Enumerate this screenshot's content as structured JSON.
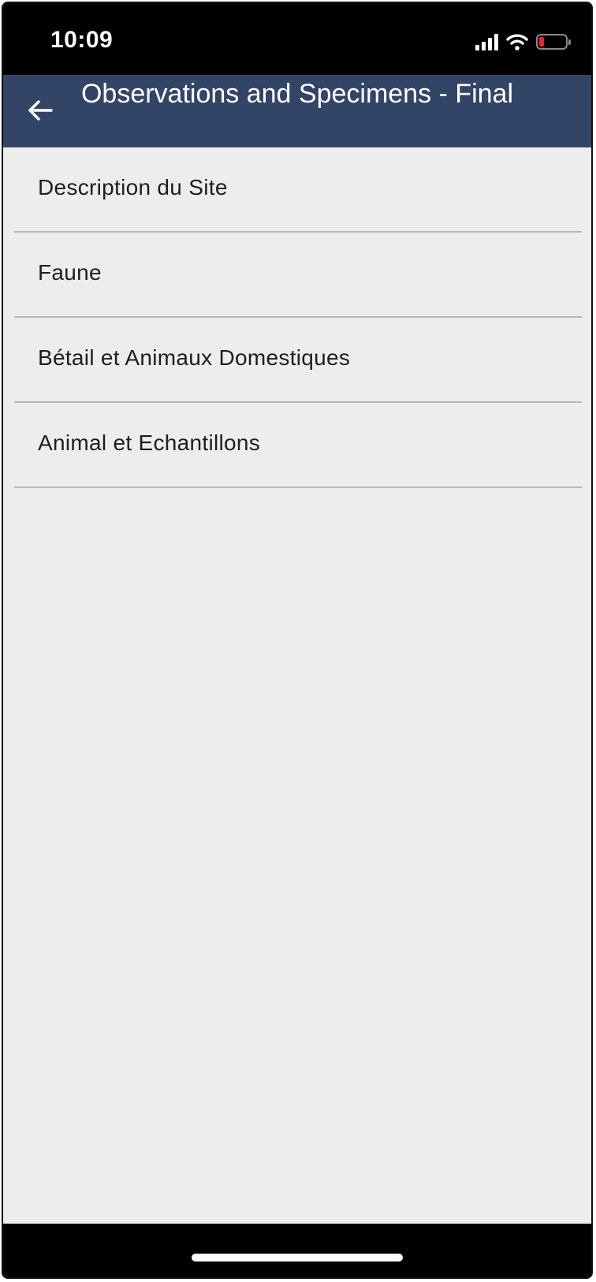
{
  "status_bar": {
    "time": "10:09",
    "icons": [
      "cellular-signal-icon",
      "wifi-icon",
      "battery-icon"
    ],
    "battery_color": "#e8262b"
  },
  "header": {
    "title": "Observations and Specimens - Final",
    "back_icon": "arrow-left-icon",
    "background": "#334567"
  },
  "menu": {
    "items": [
      {
        "label": "Description du Site"
      },
      {
        "label": "Faune"
      },
      {
        "label": "Bétail et Animaux Domestiques"
      },
      {
        "label": "Animal et Echantillons"
      }
    ]
  }
}
